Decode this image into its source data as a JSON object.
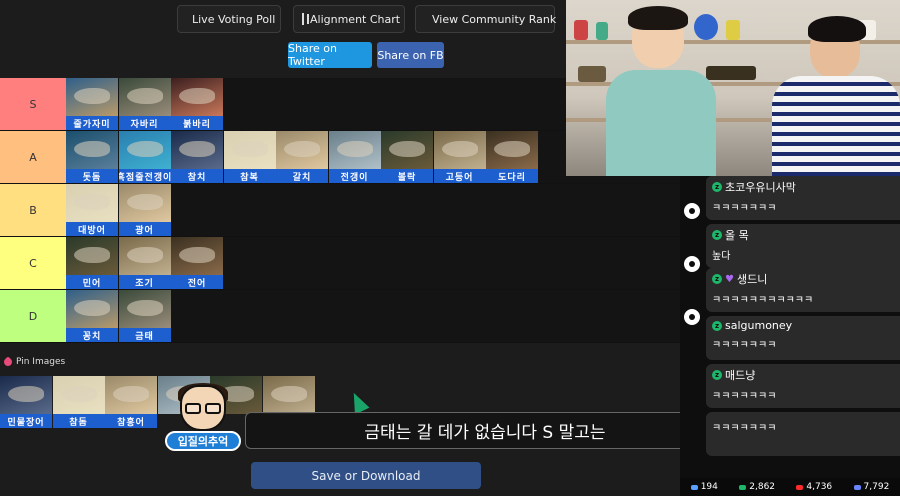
{
  "toolbar": {
    "live_voting_poll": "Live Voting Poll",
    "alignment_chart": "Alignment Chart",
    "view_community_rank": "View Community Rank",
    "share_twitter": "Share on Twitter",
    "share_fb": "Share on FB"
  },
  "tiers": [
    {
      "label": "S",
      "color": "#ff7f7f",
      "items": [
        "줄가자미",
        "자바리",
        "붉바리"
      ]
    },
    {
      "label": "A",
      "color": "#ffbf7f",
      "items": [
        "돗돔",
        "흑점줄전갱이",
        "참치",
        "참복",
        "갈치",
        "전갱이",
        "볼락",
        "고등어",
        "도다리"
      ]
    },
    {
      "label": "B",
      "color": "#ffdf7f",
      "items": [
        "대방어",
        "광어"
      ]
    },
    {
      "label": "C",
      "color": "#ffff7f",
      "items": [
        "민어",
        "조기",
        "전어"
      ]
    },
    {
      "label": "D",
      "color": "#bfff7f",
      "items": [
        "꽁치",
        "금태"
      ]
    }
  ],
  "pin": {
    "title": "Pin Images",
    "items": [
      "민물장어",
      "참돔",
      "참홍어",
      "",
      "",
      ""
    ]
  },
  "save_button": "Save or Download",
  "subtitle": "금태는 갈 데가 없습니다 S 말고는",
  "channel_tag": "입질의추억",
  "chat": [
    {
      "name": "초코우유니사막",
      "text": "ㅋㅋㅋㅋㅋㅋㅋ"
    },
    {
      "name": "올 목",
      "text": "높다"
    },
    {
      "name": "생드니",
      "text": "ㅋㅋㅋㅋㅋㅋㅋㅋㅋㅋㅋ"
    },
    {
      "name": "salgumoney",
      "text": "ㅋㅋㅋㅋㅋㅋㅋ"
    },
    {
      "name": "매드냥",
      "text": "ㅋㅋㅋㅋㅋㅋㅋ"
    },
    {
      "name": "",
      "text": "ㅋㅋㅋㅋㅋㅋㅋ"
    }
  ],
  "stats": {
    "viewers_a": "194",
    "viewers_b": "2,862",
    "viewers_c": "4,736",
    "viewers_d": "7,792"
  }
}
